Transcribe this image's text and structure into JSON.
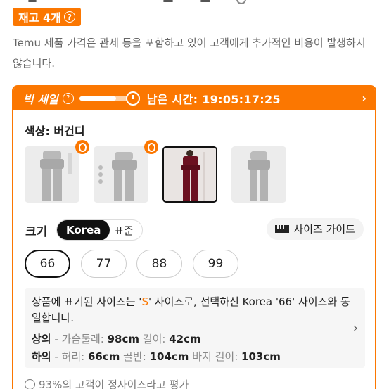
{
  "stock_badge": {
    "label": "재고 4개",
    "help_icon": "question-circle-icon"
  },
  "notice": "Temu 제품 가격은 관세 등을 포함하고 있어 고객에게 추가적인 비용이 발생하지 않습니다.",
  "sale": {
    "title": "빅 세일",
    "remaining_label": "남은 시간: 19:05:17:25",
    "progress": 0.65,
    "arrow": "›"
  },
  "color": {
    "label": "색상: 버건디",
    "thumbnails": [
      {
        "name": "gray-set-1",
        "hot": true,
        "selected": false
      },
      {
        "name": "gray-set-2",
        "hot": true,
        "selected": false
      },
      {
        "name": "burgundy-set",
        "hot": false,
        "selected": true
      },
      {
        "name": "gray-set-3",
        "hot": false,
        "selected": false
      }
    ]
  },
  "size": {
    "label": "크기",
    "toggle": [
      "Korea",
      "표준"
    ],
    "guide": "사이즈 가이드",
    "options": [
      "66",
      "77",
      "88",
      "99"
    ],
    "selected": "66"
  },
  "info": {
    "line1_a": "상품에 표기된 사이즈는 '",
    "line1_hl": "S",
    "line1_b": "' 사이즈로, 선택하신 Korea '66' 사이즈와 동일합니다.",
    "top_label": "상의",
    "top_sep": " - ",
    "top_chest_label": "가슴둘레: ",
    "top_chest": "98cm",
    "top_len_label": " 길이: ",
    "top_len": "42cm",
    "bottom_label": "하의",
    "bottom_sep": " - ",
    "bottom_waist_label": "허리: ",
    "bottom_waist": "66cm",
    "bottom_hip_label": " 골반: ",
    "bottom_hip": "104cm",
    "bottom_len_label": " 바지 길이: ",
    "bottom_len": "103cm",
    "chevron": "›"
  },
  "fit": {
    "text": "93%의 고객이 정사이즈라고 평가"
  },
  "colors": {
    "accent": "#fb7701",
    "burgundy": "#6b1020"
  }
}
